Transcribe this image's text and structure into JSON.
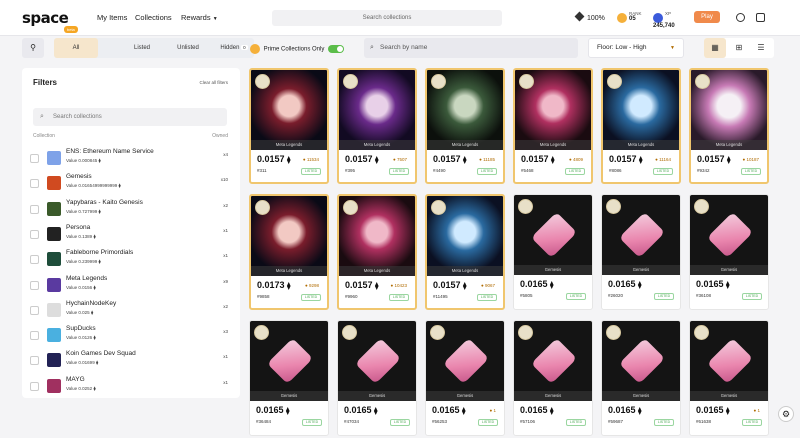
{
  "header": {
    "logo": "space",
    "logo_badge": "beta",
    "nav": [
      "My Items",
      "Collections",
      "Rewards"
    ],
    "search_placeholder": "Search collections",
    "percent": "100%",
    "rank_label": "RANK",
    "rank_value": "05",
    "xp_label": "XP",
    "xp_value": "245,740",
    "play_label": "Play"
  },
  "toolbar": {
    "tabs": [
      "All",
      "Listed",
      "Unlisted"
    ],
    "hidden_label": "Hidden",
    "hidden_count": "0",
    "prime_label": "Prime Collections Only",
    "search_placeholder": "Search by name",
    "sort_label": "Floor: Low - High"
  },
  "sidebar": {
    "title": "Filters",
    "clear_label": "Clear all filters",
    "search_placeholder": "Search collections",
    "col_collection": "Collection",
    "col_owned": "Owned",
    "collections": [
      {
        "name": "ENS: Ethereum Name Service",
        "value": "Value 0.000845",
        "owned": "x4"
      },
      {
        "name": "Gemesis",
        "value": "Value 0.01654999999999",
        "owned": "x10"
      },
      {
        "name": "Yapybaras - Kaito Genesis",
        "value": "Value 0.727999",
        "owned": "x2"
      },
      {
        "name": "Persona",
        "value": "Value 0.1389",
        "owned": "x1"
      },
      {
        "name": "Fableborne Primordials",
        "value": "Value 0.239999",
        "owned": "x1"
      },
      {
        "name": "Meta Legends",
        "value": "Value 0.0156",
        "owned": "x9"
      },
      {
        "name": "HychainNodeKey",
        "value": "Value 0.025",
        "owned": "x2"
      },
      {
        "name": "SupDucks",
        "value": "Value 0.0126",
        "owned": "x3"
      },
      {
        "name": "Koin Games Dev Squad",
        "value": "Value 0.01699",
        "owned": "x1"
      },
      {
        "name": "MAYG",
        "value": "Value 0.0252",
        "owned": "x1"
      }
    ]
  },
  "cards": [
    {
      "collection": "Meta Legends",
      "price": "0.0157",
      "rank": "11534",
      "id": "#311",
      "status": "LISTED",
      "art": "dark1"
    },
    {
      "collection": "Meta Legends",
      "price": "0.0157",
      "rank": "7507",
      "id": "#395",
      "status": "LISTED",
      "art": "dark2"
    },
    {
      "collection": "Meta Legends",
      "price": "0.0157",
      "rank": "11185",
      "id": "#4490",
      "status": "LISTED",
      "art": "dark3"
    },
    {
      "collection": "Meta Legends",
      "price": "0.0157",
      "rank": "4809",
      "id": "#5468",
      "status": "LISTED",
      "art": "dark4"
    },
    {
      "collection": "Meta Legends",
      "price": "0.0157",
      "rank": "11164",
      "id": "#8086",
      "status": "LISTED",
      "art": "dark5"
    },
    {
      "collection": "Meta Legends",
      "price": "0.0157",
      "rank": "10187",
      "id": "#9342",
      "status": "LISTED",
      "art": "dark6"
    },
    {
      "collection": "Meta Legends",
      "price": "0.0173",
      "rank": "9298",
      "id": "#9858",
      "status": "LISTED",
      "art": "dark1"
    },
    {
      "collection": "Meta Legends",
      "price": "0.0157",
      "rank": "10423",
      "id": "#9960",
      "status": "LISTED",
      "art": "dark4"
    },
    {
      "collection": "Meta Legends",
      "price": "0.0157",
      "rank": "9067",
      "id": "#11495",
      "status": "LISTED",
      "art": "dark5"
    },
    {
      "collection": "Gemesis",
      "price": "0.0165",
      "rank": "",
      "id": "#5805",
      "status": "LISTED",
      "art": "gem"
    },
    {
      "collection": "Gemesis",
      "price": "0.0165",
      "rank": "",
      "id": "#26020",
      "status": "LISTED",
      "art": "gem"
    },
    {
      "collection": "Gemesis",
      "price": "0.0165",
      "rank": "",
      "id": "#36108",
      "status": "LISTED",
      "art": "gem"
    },
    {
      "collection": "Gemesis",
      "price": "0.0165",
      "rank": "",
      "id": "#36484",
      "status": "LISTED",
      "art": "gem"
    },
    {
      "collection": "Gemesis",
      "price": "0.0165",
      "rank": "",
      "id": "#47034",
      "status": "LISTED",
      "art": "gem"
    },
    {
      "collection": "Gemesis",
      "price": "0.0165",
      "rank": "1",
      "id": "#56253",
      "status": "LISTED",
      "art": "gem"
    },
    {
      "collection": "Gemesis",
      "price": "0.0165",
      "rank": "",
      "id": "#57106",
      "status": "LISTED",
      "art": "gem"
    },
    {
      "collection": "Gemesis",
      "price": "0.0165",
      "rank": "",
      "id": "#59687",
      "status": "LISTED",
      "art": "gem"
    },
    {
      "collection": "Gemesis",
      "price": "0.0165",
      "rank": "1",
      "id": "#61638",
      "status": "LISTED",
      "art": "gem"
    }
  ],
  "colors": {
    "accent": "#f5a623",
    "listed": "#4caa55",
    "play": "#f08a4b"
  }
}
